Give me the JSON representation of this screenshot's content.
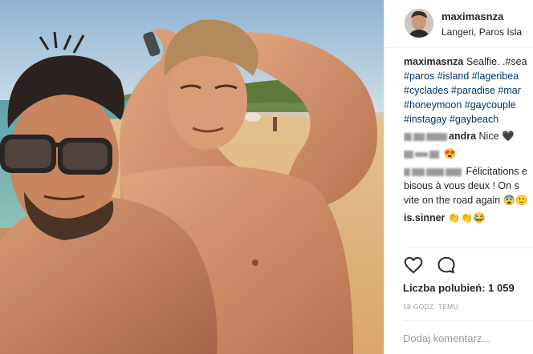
{
  "post": {
    "username": "maximasnza",
    "location": "Langeri, Paros Isla",
    "photo_alt": "selfie-photo"
  },
  "caption": {
    "username": "maximasnza",
    "text": "Sealfie. .#sea",
    "hashtags_line1": "#paros #island #lageribea",
    "hashtags_line2": "#cyclades #paradise #mar",
    "hashtags_line3": "#honeymoon #gaycouple",
    "hashtags_line4": "#instagay #gaybeach"
  },
  "comments": [
    {
      "user_visible": "andra",
      "text": "Nice 🖤"
    },
    {
      "user_visible": "",
      "text": "😍"
    },
    {
      "user_visible": "",
      "text": "Félicitations e"
    },
    {
      "user_visible": "",
      "text": "bisous à vous deux ! On s"
    },
    {
      "user_visible": "",
      "text": "vite on the road again 😨🙂"
    },
    {
      "user_visible": "is.sinner",
      "text": "👏👏😂"
    }
  ],
  "actions": {
    "like_icon": "heart-icon",
    "comment_icon": "speech-bubble-icon"
  },
  "likes_text": "Liczba polubień: 1 059",
  "timestamp": "18 GODZ. TEMU",
  "comment_input": {
    "placeholder": "Dodaj komentarz..."
  },
  "colors": {
    "text": "#262626",
    "hashtag": "#003569",
    "muted": "#999999",
    "separator": "#efefef"
  }
}
